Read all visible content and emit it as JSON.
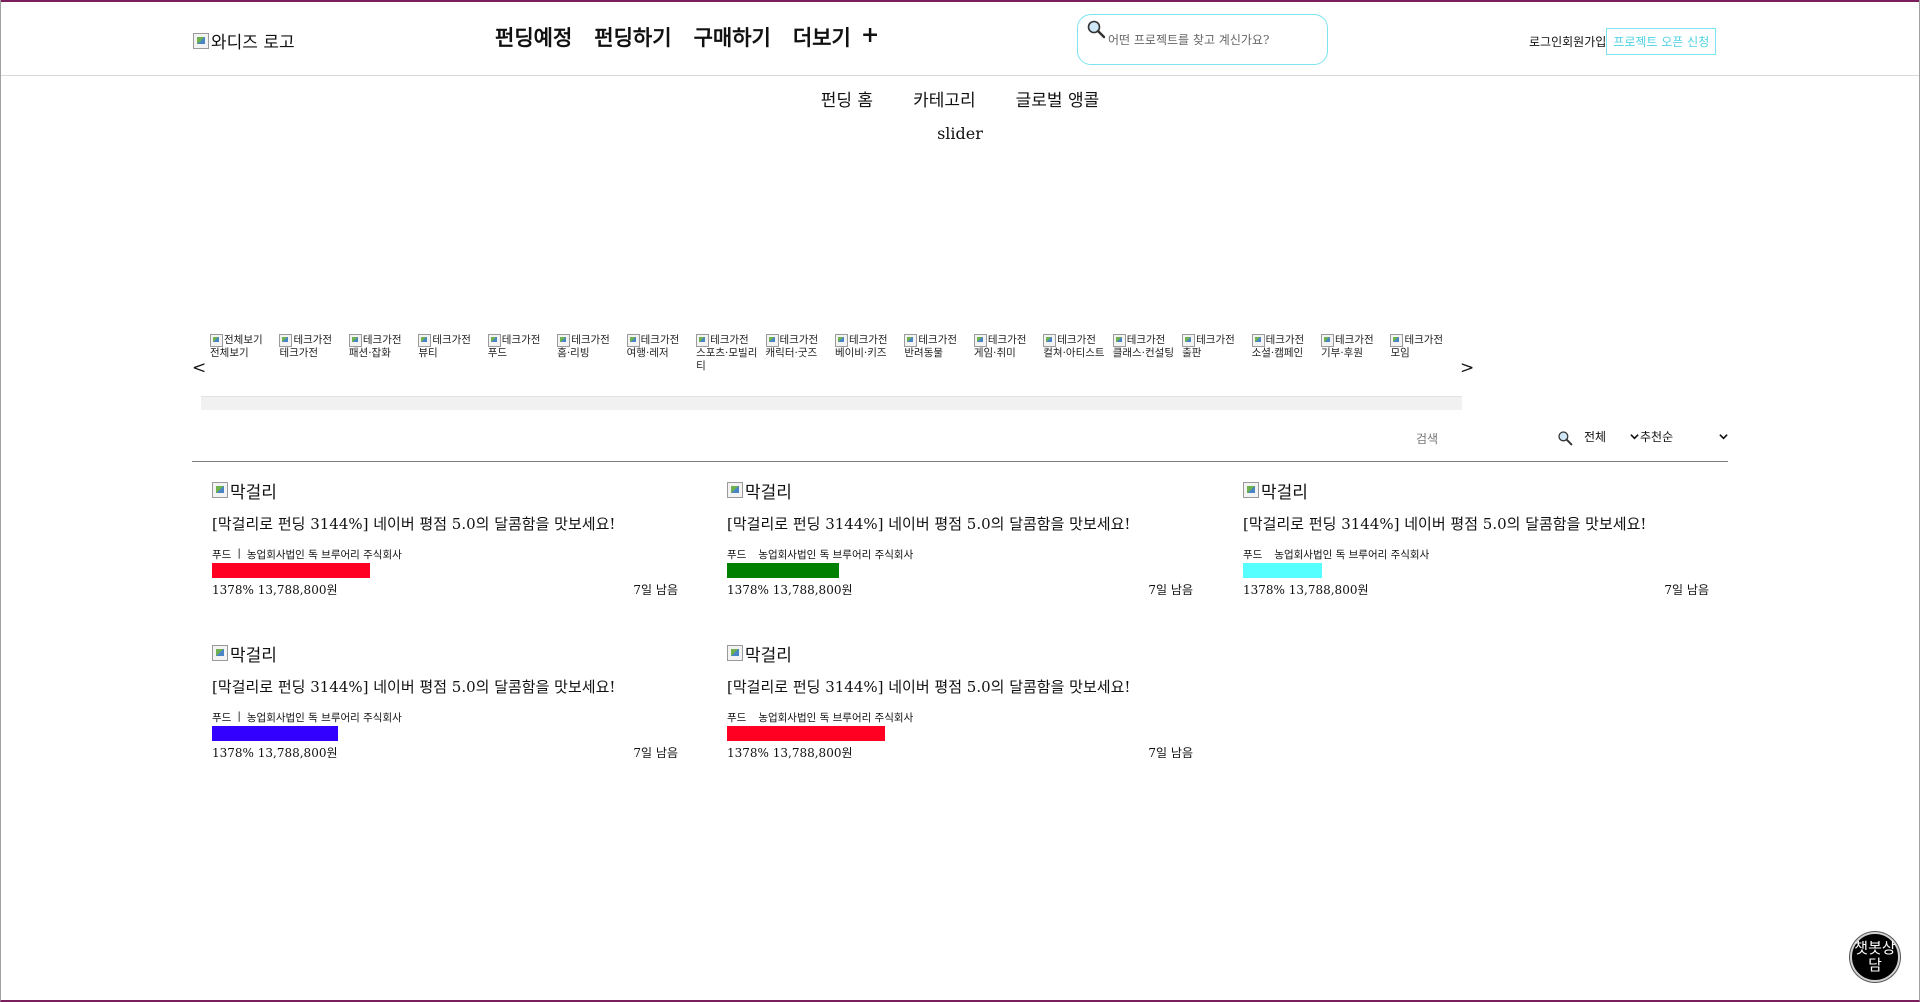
{
  "header": {
    "logo_alt": "와디즈 로고",
    "nav": [
      "펀딩예정",
      "펀딩하기",
      "구매하기",
      "더보기"
    ],
    "more_symbol": "+",
    "search_placeholder": "어떤 프로젝트를 찾고 계신가요?",
    "login": "로그인",
    "signup": "회원가입",
    "open_project": "프로젝트 오픈 신청"
  },
  "subnav": [
    "펀딩 홈",
    "카테고리",
    "글로벌 앵콜"
  ],
  "slider_label": "slider",
  "carousel": {
    "prev": "<",
    "next": ">",
    "items": [
      {
        "alt": "전체보기",
        "label": "전체보기"
      },
      {
        "alt": "테크가전",
        "label": "테크가전"
      },
      {
        "alt": "테크가전",
        "label": "패션·잡화"
      },
      {
        "alt": "테크가전",
        "label": "뷰티"
      },
      {
        "alt": "테크가전",
        "label": "푸드"
      },
      {
        "alt": "테크가전",
        "label": "홈·리빙"
      },
      {
        "alt": "테크가전",
        "label": "여행·레저"
      },
      {
        "alt": "테크가전",
        "label": "스포츠·모빌리티"
      },
      {
        "alt": "테크가전",
        "label": "캐릭터·굿즈"
      },
      {
        "alt": "테크가전",
        "label": "베이비·키즈"
      },
      {
        "alt": "테크가전",
        "label": "반려동물"
      },
      {
        "alt": "테크가전",
        "label": "게임·취미"
      },
      {
        "alt": "테크가전",
        "label": "컬쳐·아티스트"
      },
      {
        "alt": "테크가전",
        "label": "클래스·컨설팅"
      },
      {
        "alt": "테크가전",
        "label": "출판"
      },
      {
        "alt": "테크가전",
        "label": "소셜·캠페인"
      },
      {
        "alt": "테크가전",
        "label": "기부·후원"
      },
      {
        "alt": "테크가전",
        "label": "모임"
      }
    ]
  },
  "filters": {
    "search_placeholder": "검색",
    "scope": "전체",
    "sort": "추천순"
  },
  "projects": [
    {
      "image_alt": "막걸리",
      "title": "[막걸리로 펀딩 3144%] 네이버 평점 5.0의 달콤함을 맛보세요!",
      "category": "푸드",
      "sep": "|",
      "maker": "농업회사법인 독 브루어리 주식회사",
      "bar_color": "#ff0022",
      "bar_fraction": 0.34,
      "stats": "1378% 13,788,800원",
      "remaining": "7일 남음"
    },
    {
      "image_alt": "막걸리",
      "title": "[막걸리로 펀딩 3144%] 네이버 평점 5.0의 달콤함을 맛보세요!",
      "category": "푸드",
      "sep": "",
      "maker": "농업회사법인 독 브루어리 주식회사",
      "bar_color": "#008000",
      "bar_fraction": 0.24,
      "stats": "1378% 13,788,800원",
      "remaining": "7일 남음"
    },
    {
      "image_alt": "막걸리",
      "title": "[막걸리로 펀딩 3144%] 네이버 평점 5.0의 달콤함을 맛보세요!",
      "category": "푸드",
      "sep": "",
      "maker": "농업회사법인 독 브루어리 주식회사",
      "bar_color": "#55ffff",
      "bar_fraction": 0.17,
      "stats": "1378% 13,788,800원",
      "remaining": "7일 남음"
    },
    {
      "image_alt": "막걸리",
      "title": "[막걸리로 펀딩 3144%] 네이버 평점 5.0의 달콤함을 맛보세요!",
      "category": "푸드",
      "sep": "|",
      "maker": "농업회사법인 독 브루어리 주식회사",
      "bar_color": "#3300ff",
      "bar_fraction": 0.27,
      "stats": "1378% 13,788,800원",
      "remaining": "7일 남음"
    },
    {
      "image_alt": "막걸리",
      "title": "[막걸리로 펀딩 3144%] 네이버 평점 5.0의 달콤함을 맛보세요!",
      "category": "푸드",
      "sep": "",
      "maker": "농업회사법인 독 브루어리 주식회사",
      "bar_color": "#ff0022",
      "bar_fraction": 0.34,
      "stats": "1378% 13,788,800원",
      "remaining": "7일 남음"
    }
  ],
  "chatbot_label": "챗봇상담",
  "icons": {
    "search": "search-icon",
    "chevron": "chevron-down-icon",
    "broken_image": "broken-image-icon"
  }
}
